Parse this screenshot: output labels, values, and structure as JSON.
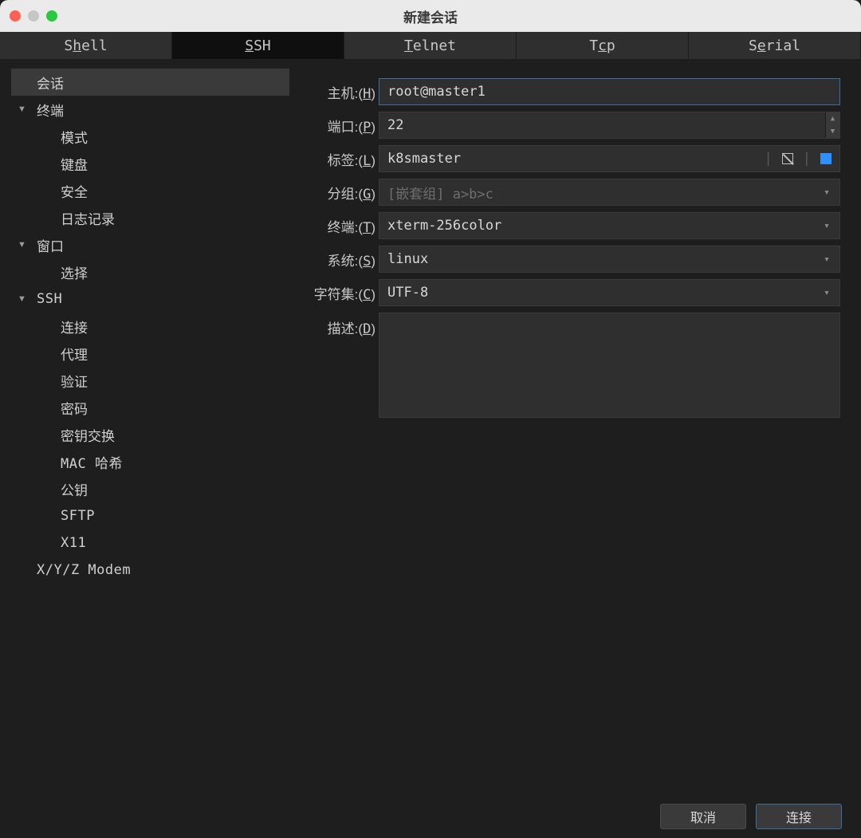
{
  "window": {
    "title": "新建会话"
  },
  "tabs": [
    {
      "label_pre": "S",
      "underline": "h",
      "label_post": "ell"
    },
    {
      "label_pre": "",
      "underline": "S",
      "label_post": "SH"
    },
    {
      "label_pre": "",
      "underline": "T",
      "label_post": "elnet"
    },
    {
      "label_pre": "T",
      "underline": "c",
      "label_post": "p"
    },
    {
      "label_pre": "S",
      "underline": "e",
      "label_post": "rial"
    }
  ],
  "sidebar": {
    "items": {
      "session": "会话",
      "terminal": "终端",
      "mode": "模式",
      "keyboard": "键盘",
      "security": "安全",
      "logging": "日志记录",
      "window": "窗口",
      "select": "选择",
      "ssh": "SSH",
      "connect": "连接",
      "proxy": "代理",
      "auth": "验证",
      "password": "密码",
      "kex": "密钥交换",
      "mac": "MAC 哈希",
      "pubkey": "公钥",
      "sftp": "SFTP",
      "x11": "X11",
      "modem": "X/Y/Z Modem"
    }
  },
  "form": {
    "host": {
      "label": "主机:",
      "shortcut": "H",
      "value": "root@master1"
    },
    "port": {
      "label": "端口:",
      "shortcut": "P",
      "value": "22"
    },
    "tag": {
      "label": "标签:",
      "shortcut": "L",
      "value": "k8smaster"
    },
    "group": {
      "label": "分组:",
      "shortcut": "G",
      "placeholder": "[嵌套组] a>b>c"
    },
    "terminal": {
      "label": "终端:",
      "shortcut": "T",
      "value": "xterm-256color"
    },
    "system": {
      "label": "系统:",
      "shortcut": "S",
      "value": "linux"
    },
    "charset": {
      "label": "字符集:",
      "shortcut": "C",
      "value": "UTF-8"
    },
    "desc": {
      "label": "描述:",
      "shortcut": "D",
      "value": ""
    }
  },
  "footer": {
    "cancel": "取消",
    "connect": "连接"
  },
  "colors": {
    "tag_swatch": "#2e8fff"
  }
}
